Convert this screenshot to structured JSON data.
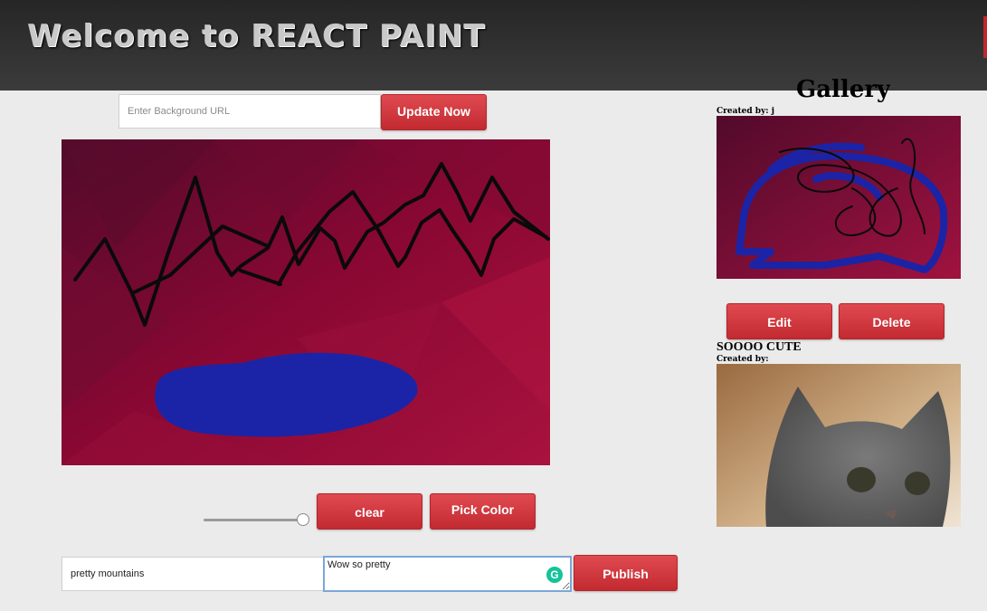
{
  "header": {
    "title": "Welcome to REACT PAINT"
  },
  "background_form": {
    "placeholder": "Enter Background URL",
    "update_label": "Update Now"
  },
  "tools": {
    "clear_label": "clear",
    "pick_color_label": "Pick Color",
    "brush_size": 1
  },
  "publish_form": {
    "title_value": "pretty mountains",
    "description_value": "Wow so pretty",
    "publish_label": "Publish"
  },
  "gallery": {
    "heading": "Gallery",
    "items": [
      {
        "title": "",
        "created_by": "Created by: j",
        "edit_label": "Edit",
        "delete_label": "Delete"
      },
      {
        "title": "SOOOO CUTE",
        "created_by": "Created by:"
      }
    ]
  },
  "colors": {
    "accent": "#d23a40",
    "header_bg": "#2e2e2e",
    "canvas_bg": "#8c0a34",
    "stroke_black": "#0a0a0a",
    "stroke_blue": "#1b24a6"
  },
  "icons": {
    "grammarly": "grammarly-icon"
  }
}
